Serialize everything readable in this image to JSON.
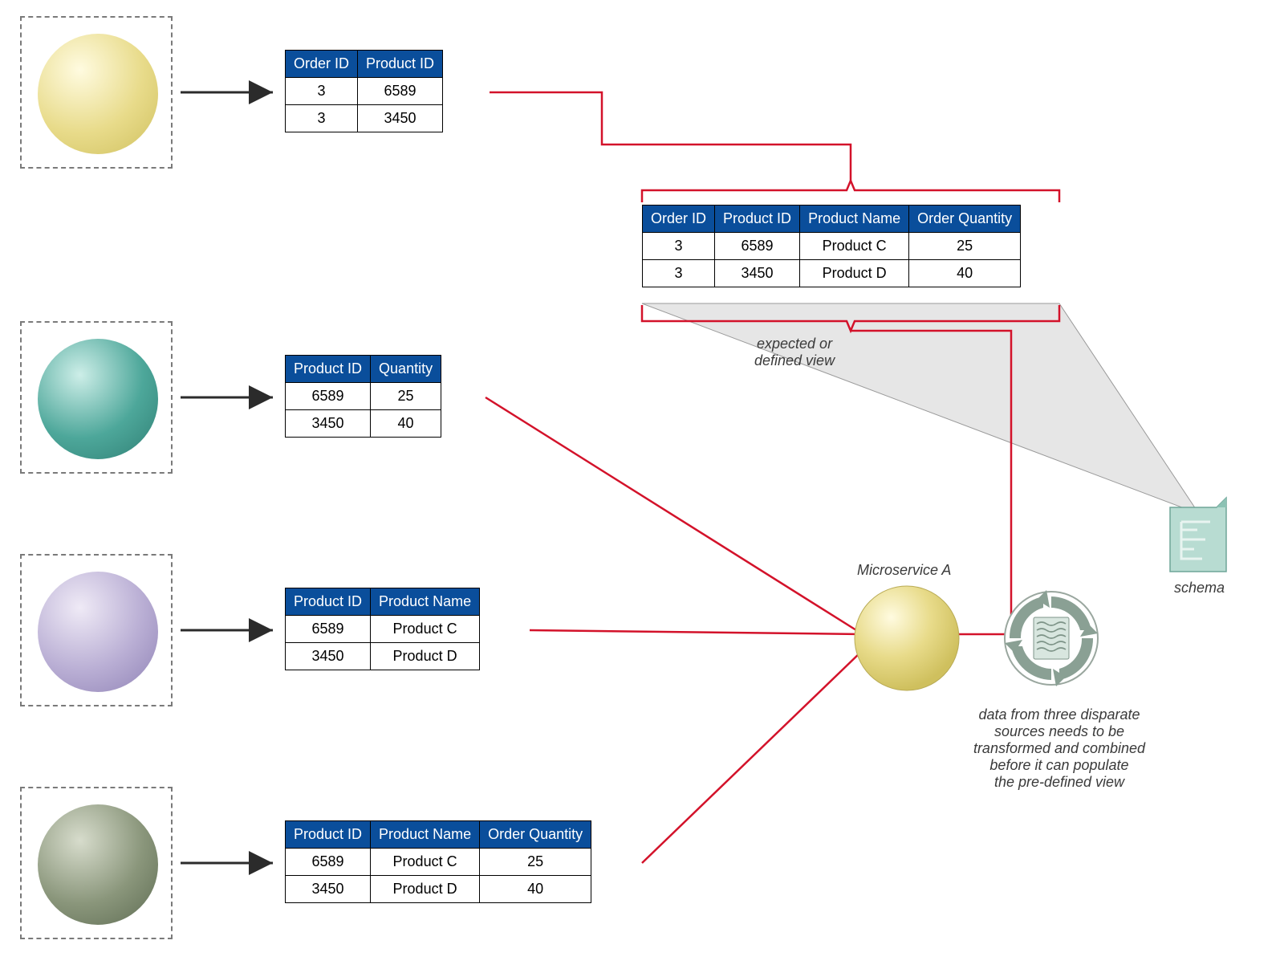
{
  "tables": {
    "t1": {
      "headers": [
        "Order ID",
        "Product ID"
      ],
      "rows": [
        [
          "3",
          "6589"
        ],
        [
          "3",
          "3450"
        ]
      ]
    },
    "t2": {
      "headers": [
        "Product ID",
        "Quantity"
      ],
      "rows": [
        [
          "6589",
          "25"
        ],
        [
          "3450",
          "40"
        ]
      ]
    },
    "t3": {
      "headers": [
        "Product ID",
        "Product Name"
      ],
      "rows": [
        [
          "6589",
          "Product C"
        ],
        [
          "3450",
          "Product D"
        ]
      ]
    },
    "t4": {
      "headers": [
        "Product ID",
        "Product Name",
        "Order Quantity"
      ],
      "rows": [
        [
          "6589",
          "Product C",
          "25"
        ],
        [
          "3450",
          "Product D",
          "40"
        ]
      ]
    },
    "combined": {
      "headers": [
        "Order ID",
        "Product ID",
        "Product Name",
        "Order Quantity"
      ],
      "rows": [
        [
          "3",
          "6589",
          "Product C",
          "25"
        ],
        [
          "3",
          "3450",
          "Product D",
          "40"
        ]
      ]
    }
  },
  "labels": {
    "expected_view": "expected or\ndefined view",
    "microservice": "Microservice A",
    "combine_note": "data from three disparate\nsources needs to be\ntransformed and combined\nbefore it can populate\nthe pre-defined view",
    "schema": "schema"
  },
  "colors": {
    "header_bg": "#0a4e9b",
    "red_line": "#d3122a",
    "arrow": "#2b2b2b"
  }
}
